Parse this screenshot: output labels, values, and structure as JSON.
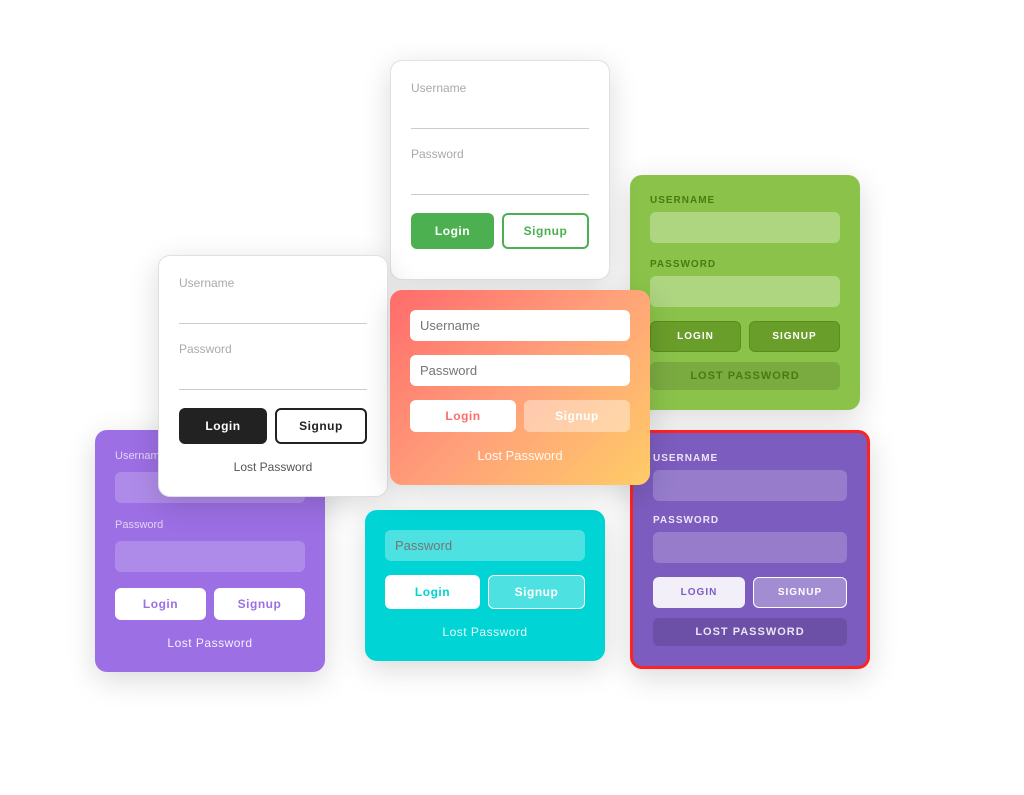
{
  "cards": {
    "white_top": {
      "username_placeholder": "Username",
      "password_placeholder": "Password",
      "login_label": "Login",
      "signup_label": "Signup"
    },
    "white_black": {
      "username_placeholder": "Username",
      "password_placeholder": "Password",
      "login_label": "Login",
      "signup_label": "Signup",
      "lost_pw": "Lost Password"
    },
    "coral": {
      "username_placeholder": "Username",
      "password_placeholder": "Password",
      "login_label": "Login",
      "signup_label": "Signup",
      "lost_pw": "Lost Password"
    },
    "green": {
      "username_label": "USERNAME",
      "password_label": "PASSWORD",
      "login_label": "LOGIN",
      "signup_label": "SIGNUP",
      "lost_pw": "LOST PASSWORD"
    },
    "purple": {
      "username_placeholder": "Username",
      "password_placeholder": "Password",
      "login_label": "Login",
      "signup_label": "Signup",
      "lost_pw": "Lost Password"
    },
    "cyan": {
      "password_placeholder": "Password",
      "login_label": "Login",
      "signup_label": "Signup",
      "lost_pw": "Lost Password"
    },
    "violet": {
      "username_label": "USERNAME",
      "password_label": "PASSWORD",
      "login_label": "LOGIN",
      "signup_label": "SIGNUP",
      "lost_pw": "LOST PASSWORD"
    }
  }
}
